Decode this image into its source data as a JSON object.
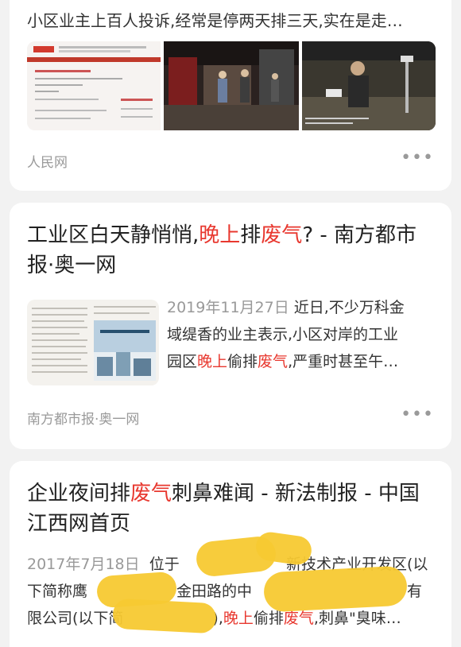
{
  "results": [
    {
      "snippet": "小区业主上百人投诉,经常是停两天排三天,实在是走…",
      "source": "人民网",
      "more": "•••"
    },
    {
      "title_parts": [
        "工业区白天静悄悄,",
        "晚上",
        "排",
        "废气",
        "? - 南方都市报·奥一网"
      ],
      "date": "2019年11月27日",
      "snippet_line1": "近日,不少万科金",
      "snippet_line2": "域缇香的业主表示,小区对岸的工业",
      "snippet_line3_parts": [
        "园区",
        "晚上",
        "偷排",
        "废气",
        ",严重时甚至午…"
      ],
      "source": "南方都市报·奥一网",
      "more": "•••"
    },
    {
      "title_parts": [
        "企业夜间排",
        "废气",
        "刺鼻难闻 - 新法制报 - 中国江西网首页"
      ],
      "date": "2017年7月18日",
      "snippet_line1": "位于",
      "snippet_line1_tail": "新技术产业开发区(以",
      "snippet_line2a": "下简称鹰",
      "snippet_line2b": "金田路的中",
      "snippet_line2_tail": "有",
      "snippet_line3_parts": [
        "限公司(以下简",
        "),",
        "晚上",
        "偷排",
        "废气",
        ",刺鼻\"臭味…"
      ]
    }
  ],
  "colors": {
    "highlight": "#e8382f",
    "card_bg": "#ffffff",
    "page_bg": "#f2f2f2",
    "redaction": "#f7c932"
  }
}
